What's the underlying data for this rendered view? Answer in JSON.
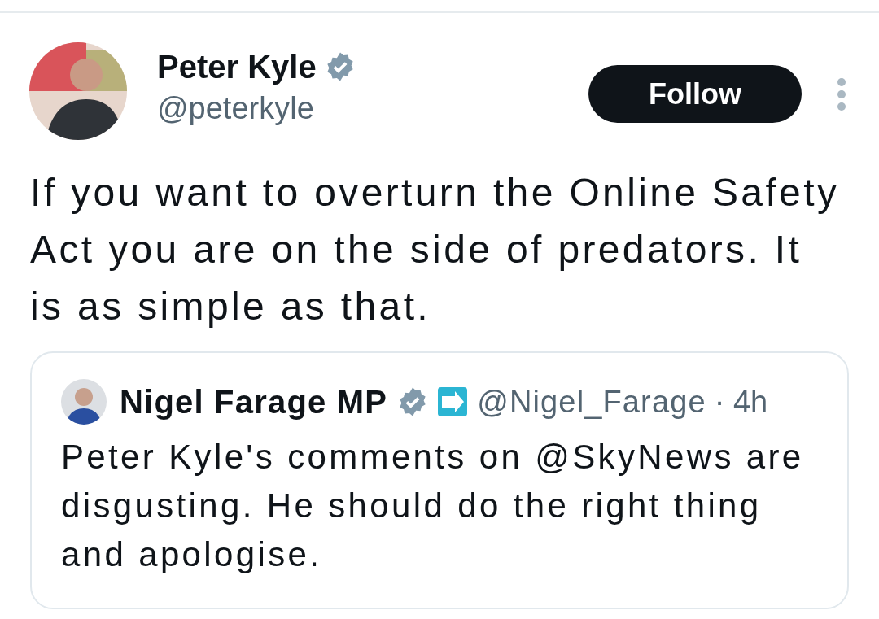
{
  "post": {
    "author": {
      "name": "Peter Kyle",
      "verified": true,
      "handle": "@peterkyle"
    },
    "follow_button": "Follow",
    "text": "If you want to overturn the Online Safety Act you are on the side of predators. It is as simple as that.",
    "quote": {
      "author": {
        "name": "Nigel Farage MP",
        "verified": true,
        "affiliate": true,
        "handle": "@Nigel_Farage",
        "time": "· 4h"
      },
      "text": "Peter Kyle's comments on @SkyNews are disgusting. He should do the right thing and apologise."
    }
  }
}
